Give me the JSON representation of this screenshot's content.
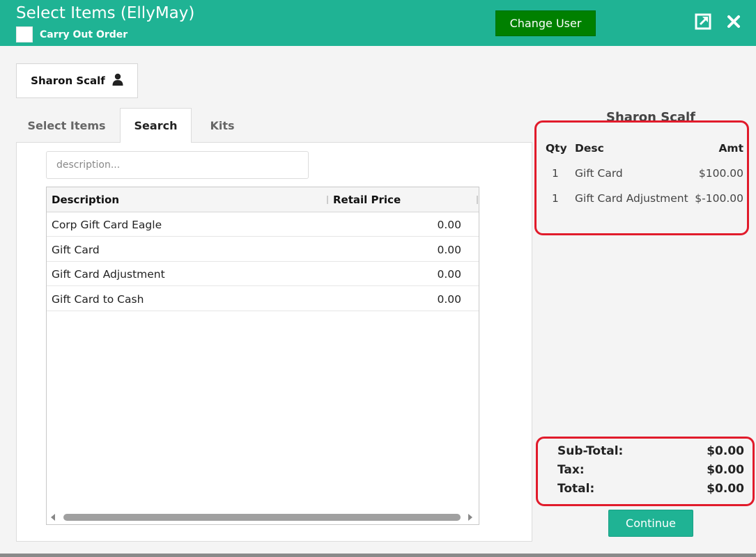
{
  "header": {
    "title": "Select Items (EllyMay)",
    "carry_out_label": "Carry Out Order",
    "change_user_label": "Change User",
    "accent_color": "#1fb394"
  },
  "customer": {
    "name": "Sharon Scalf",
    "icon": "user-icon"
  },
  "tabs": [
    {
      "label": "Select Items",
      "active": false
    },
    {
      "label": "Search",
      "active": true
    },
    {
      "label": "Kits",
      "active": false
    }
  ],
  "search": {
    "placeholder": "description...",
    "value": ""
  },
  "grid": {
    "columns": [
      "Description",
      "Retail Price"
    ],
    "rows": [
      {
        "description": "Corp Gift Card Eagle",
        "price": "0.00"
      },
      {
        "description": "Gift Card",
        "price": "0.00"
      },
      {
        "description": "Gift Card Adjustment",
        "price": "0.00"
      },
      {
        "description": "Gift Card to Cash",
        "price": "0.00"
      }
    ]
  },
  "order": {
    "customer_name": "Sharon Scalf",
    "columns": {
      "qty": "Qty",
      "desc": "Desc",
      "amt": "Amt"
    },
    "items": [
      {
        "qty": "1",
        "desc": "Gift Card",
        "amt": "$100.00"
      },
      {
        "qty": "1",
        "desc": "Gift Card Adjustment",
        "amt": "$-100.00"
      }
    ],
    "subtotal_label": "Sub-Total:",
    "subtotal_value": "$0.00",
    "tax_label": "Tax:",
    "tax_value": "$0.00",
    "total_label": "Total:",
    "total_value": "$0.00",
    "highlight_color": "#e11b2b"
  },
  "continue_label": "Continue"
}
